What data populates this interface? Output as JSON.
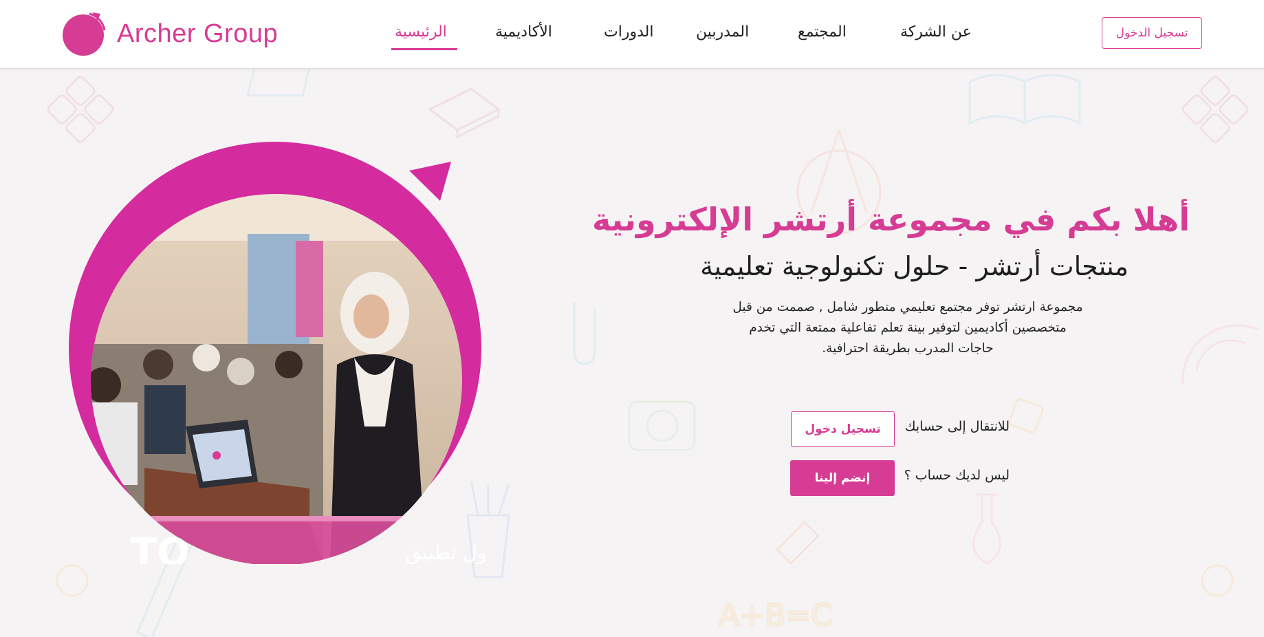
{
  "brand": {
    "name": "Archer Group",
    "accent_color": "#d83a92"
  },
  "nav": {
    "items": [
      {
        "label": "الرئيسية",
        "active": true
      },
      {
        "label": "الأكاديمية",
        "active": false
      },
      {
        "label": "الدورات",
        "active": false
      },
      {
        "label": "المدربين",
        "active": false
      },
      {
        "label": "المجتمع",
        "active": false
      },
      {
        "label": "عن الشركة",
        "active": false
      }
    ],
    "login_button": "تسجيل الدخول"
  },
  "hero": {
    "title": "أهلا بكم في مجموعة أرتشر الإلكترونية",
    "subtitle": "منتجات أرتشر - حلول تكنولوجية تعليمية",
    "description_lines": [
      "مجموعة ارتشر توفر مجتمع تعليمي متطور شامل , صممت من قبل",
      "متخصصين أكاديمين لتوفير بينة تعلم تفاعلية ممتعة التي تخدم",
      "حاجات المدرب بطريقة احترافية."
    ],
    "login_prompt": "للانتقال إلى حسابك",
    "login_button": "تسجيل دخول",
    "join_prompt": "ليس لديك حساب ؟",
    "join_button": "إنضم إلينا"
  },
  "photo": {
    "banner_text": "الإيفنت الخاص بأول تطبيق",
    "banner_logo": "TO"
  }
}
